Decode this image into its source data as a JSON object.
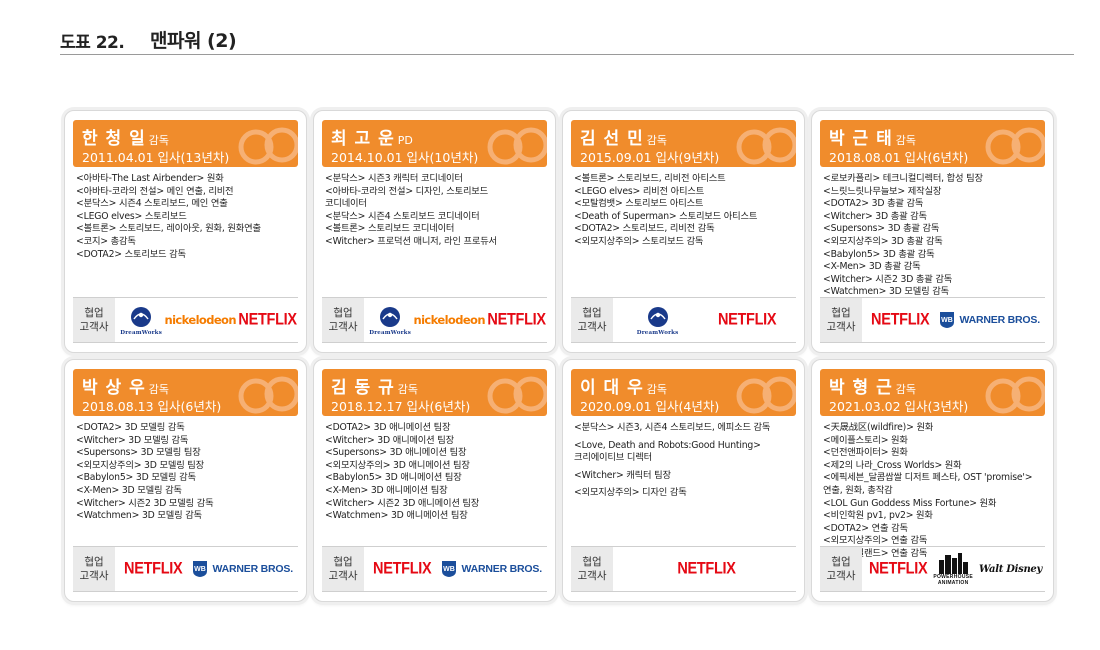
{
  "header": {
    "figure_no": "도표 22.",
    "title": "맨파워 (2)"
  },
  "client_label": "협업\n고객사",
  "logo_text": {
    "netflix": "NETFLIX",
    "nickelodeon": "nickelodeon",
    "dreamworks": "DreamWorks",
    "warner": "WARNER BROS.",
    "powerhouse": "POWERHOUSE",
    "powerhouse_sub": "ANIMATION",
    "disney": "Walt Disney"
  },
  "colors": {
    "header_orange": "#f08c2c",
    "netflix_red": "#e50914",
    "nick_orange": "#f57c00",
    "warner_blue": "#1b4e9b"
  },
  "cards": [
    {
      "name": "한 청 일",
      "role": "감독",
      "joined": "2011.04.01 입사(13년차)",
      "career": [
        "<아바타-The Last Airbender> 원화",
        "<아바타-코라의 전설> 메인 연출, 리비전",
        "<분닥스> 시즌4 스토리보드, 메인 연출",
        "<LEGO elves> 스토리보드",
        "<볼트론> 스토리보드, 레이아웃, 원화, 원화연출",
        "<코지> 총감독",
        "<DOTA2> 스토리보드 감독"
      ],
      "clients": [
        "dreamworks-logo",
        "nickelodeon-logo",
        "netflix-logo"
      ]
    },
    {
      "name": "최 고 운",
      "role": "PD",
      "joined": "2014.10.01 입사(10년차)",
      "career": [
        "<분닥스> 시즌3 캐릭터 코디네이터",
        "<아바타-코라의 전설> 디자인, 스토리보드",
        "코디네이터",
        "<분닥스> 시즌4 스토리보드 코디네이터",
        "<볼트론> 스토리보드 코디네이터",
        "<Witcher> 프로덕션 매니저, 라인 프로듀서"
      ],
      "clients": [
        "dreamworks-logo",
        "nickelodeon-logo",
        "netflix-logo"
      ]
    },
    {
      "name": "김 선 민",
      "role": "감독",
      "joined": "2015.09.01 입사(9년차)",
      "career": [
        "<볼트론> 스토리보드, 리비전 아티스트",
        "<LEGO elves> 리비전 아티스트",
        "<모탈컴뱃> 스토리보드 아티스트",
        "<Death of Superman> 스토리보드 아티스트",
        "<DOTA2> 스토리보드, 리비전 감독",
        "<외모지상주의> 스토리보드 감독"
      ],
      "clients": [
        "dreamworks-logo",
        "netflix-logo"
      ]
    },
    {
      "name": "박 근 태",
      "role": "감독",
      "joined": "2018.08.01 입사(6년차)",
      "career": [
        "<로보카폴리> 테크니컬디렉터, 합성 팀장",
        "<느릿느릿나무늘보> 제작실장",
        "<DOTA2> 3D 총괄 감독",
        "<Witcher> 3D 총괄 감독",
        "<Supersons> 3D 총괄 감독",
        "<외모지상주의> 3D 총괄 감독",
        "<Babylon5> 3D 총괄 감독",
        "<X-Men> 3D 총괄 감독",
        "<Witcher> 시즌2 3D 총괄 감독",
        "<Watchmen> 3D 모델링 감독"
      ],
      "clients": [
        "netflix-logo",
        "warner-logo"
      ]
    },
    {
      "name": "박 상 우",
      "role": "감독",
      "joined": "2018.08.13 입사(6년차)",
      "career": [
        "<DOTA2> 3D 모델링 감독",
        "<Witcher> 3D 모델링 감독",
        "<Supersons> 3D 모델링 팀장",
        "<외모지상주의> 3D 모델링 팀장",
        "<Babylon5> 3D 모델링 감독",
        "<X-Men> 3D 모델링 감독",
        "<Witcher> 시즌2 3D 모델링 감독",
        "<Watchmen> 3D 모델링 감독"
      ],
      "clients": [
        "netflix-logo",
        "warner-logo"
      ]
    },
    {
      "name": "김 동 규",
      "role": "감독",
      "joined": "2018.12.17 입사(6년차)",
      "career": [
        "<DOTA2> 3D 애니메이션 팀장",
        "<Witcher> 3D 애니메이션 팀장",
        "<Supersons> 3D 애니메이션 팀장",
        "<외모지상주의> 3D 애니메이션 팀장",
        "<Babylon5> 3D 애니메이션 팀장",
        "<X-Men> 3D 애니메이션 팀장",
        "<Witcher> 시즌2 3D 애니메이션 팀장",
        "<Watchmen> 3D 애니메이션 팀장"
      ],
      "clients": [
        "netflix-logo",
        "warner-logo"
      ]
    },
    {
      "name": "이 대 우",
      "role": "감독",
      "joined": "2020.09.01 입사(4년차)",
      "career": [
        "<분닥스> 시즌3, 시즌4 스토리보드, 에피소드 감독",
        "<Love, Death and Robots:Good Hunting>\n크리에이티브 디렉터",
        "<Witcher> 캐릭터 팀장",
        "<외모지상주의> 디자인 감독"
      ],
      "clients": [
        "netflix-logo"
      ]
    },
    {
      "name": "박 형 근",
      "role": "감독",
      "joined": "2021.03.02 입사(3년차)",
      "career": [
        "<天晟战区(wildfire)> 원화",
        "<메이플스토리> 원화",
        "<던전앤파이터> 원화",
        "<제2의 나라_Cross Worlds> 원화",
        "<에픽세븐_달콤쌉쌀 디저트 페스타, OST 'promise'>",
        "연출, 원화, 총작감",
        "<LOL Gun Goddess Miss Fortune> 원화",
        "<비인학원 pv1, pv2> 원화",
        "<DOTA2> 연출 감독",
        "<외모지상주의> 연출 감독",
        "<스컬아일랜드> 연출 감독"
      ],
      "clients": [
        "netflix-logo",
        "powerhouse-logo",
        "disney-logo"
      ]
    }
  ]
}
